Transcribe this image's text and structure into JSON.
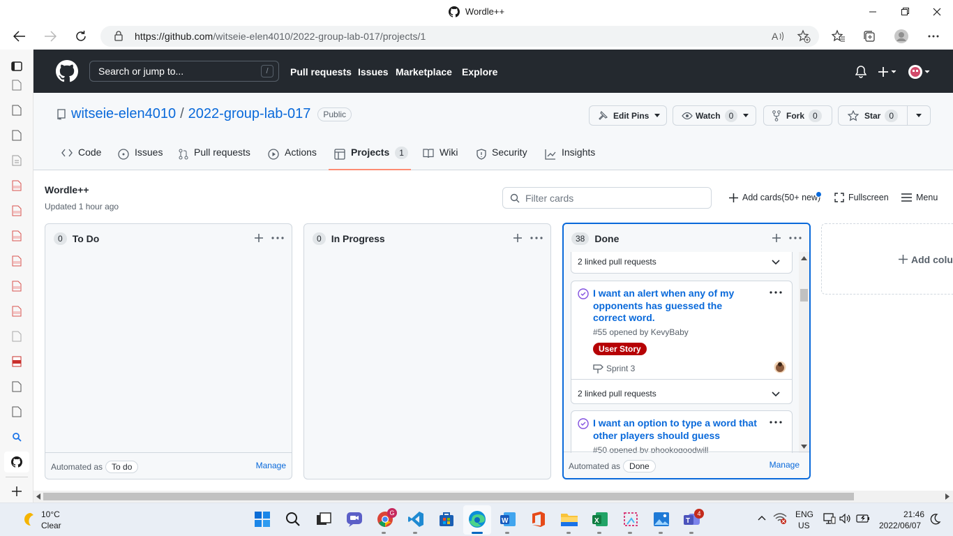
{
  "window": {
    "title": "Wordle++"
  },
  "browser": {
    "url_host": "https://github.com",
    "url_path": "/witseie-elen4010/2022-group-lab-017/projects/1"
  },
  "github_header": {
    "search_placeholder": "Search or jump to...",
    "search_shortcut": "/",
    "nav": [
      "Pull requests",
      "Issues",
      "Marketplace",
      "Explore"
    ]
  },
  "repo": {
    "owner": "witseie-elen4010",
    "separator": "/",
    "name": "2022-group-lab-017",
    "visibility": "Public",
    "edit_pins": "Edit Pins",
    "watch": {
      "label": "Watch",
      "count": "0"
    },
    "fork": {
      "label": "Fork",
      "count": "0"
    },
    "star": {
      "label": "Star",
      "count": "0"
    }
  },
  "tabs": [
    {
      "label": "Code"
    },
    {
      "label": "Issues"
    },
    {
      "label": "Pull requests"
    },
    {
      "label": "Actions"
    },
    {
      "label": "Projects",
      "count": "1"
    },
    {
      "label": "Wiki"
    },
    {
      "label": "Security"
    },
    {
      "label": "Insights"
    }
  ],
  "project": {
    "title": "Wordle++",
    "updated": "Updated 1 hour ago",
    "filter_placeholder": "Filter cards",
    "add_cards": "Add cards(50+ new)",
    "fullscreen": "Fullscreen",
    "menu": "Menu",
    "add_column": "Add colu"
  },
  "columns": [
    {
      "count": "0",
      "name": "To Do",
      "automated": "Automated as",
      "automation": "To do",
      "manage": "Manage"
    },
    {
      "count": "0",
      "name": "In Progress"
    },
    {
      "count": "38",
      "name": "Done",
      "automated": "Automated as",
      "automation": "Done",
      "manage": "Manage"
    }
  ],
  "cards": [
    {
      "linked": "2 linked pull requests"
    },
    {
      "title": "I want an alert when any of my opponents has guessed the correct word.",
      "opened": "#55 opened by KevyBaby",
      "label": "User Story",
      "milestone": "Sprint 3",
      "linked": "2 linked pull requests"
    },
    {
      "title": "I want an option to type a word that other players should guess",
      "opened": "#50 opened by phookogoodwill"
    }
  ],
  "taskbar": {
    "weather_temp": "10°C",
    "weather_desc": "Clear",
    "lang": "ENG",
    "region": "US",
    "time": "21:46",
    "date": "2022/06/07",
    "chrome_badge": "G",
    "teams_badge": "4"
  },
  "colors": {
    "header": "#24292f",
    "link": "#0969da",
    "label_user_story": "#b60205",
    "tab_underline": "#fd8c73"
  }
}
